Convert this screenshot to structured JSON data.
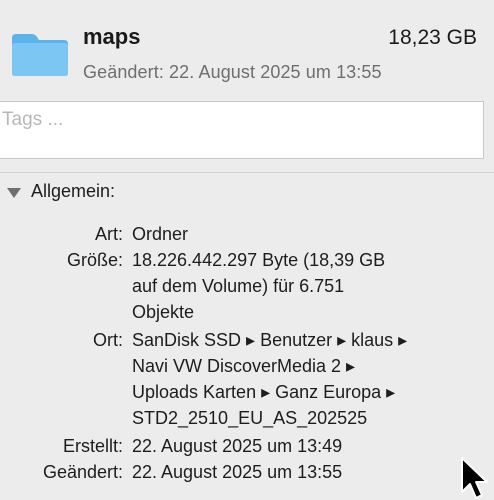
{
  "header": {
    "name": "maps",
    "size": "18,23 GB",
    "modified": "Geändert: 22. August 2025 um 13:55",
    "icon": "folder-icon"
  },
  "tags": {
    "placeholder": "Tags ..."
  },
  "section": {
    "title": "Allgemein:",
    "icon": "disclosure-triangle-down-icon"
  },
  "info": {
    "kind_label": "Art:",
    "kind_value": "Ordner",
    "size_label": "Größe:",
    "size_lines": [
      "18.226.442.297 Byte (18,39 GB",
      "auf dem Volume) für 6.751",
      "Objekte"
    ],
    "where_label": "Ort:",
    "where_lines": [
      "SanDisk SSD ▸ Benutzer ▸ klaus ▸",
      "Navi VW DiscoverMedia 2 ▸",
      "Uploads Karten ▸ Ganz Europa ▸",
      "STD2_2510_EU_AS_202525"
    ],
    "created_label": "Erstellt:",
    "created_value": "22. August 2025 um 13:49",
    "modified_label": "Geändert:",
    "modified_value": "22. August 2025 um 13:55"
  },
  "colors": {
    "folder_blue": "#6bbdf0",
    "background": "#ececec",
    "secondary_text": "#6e6e6e"
  }
}
